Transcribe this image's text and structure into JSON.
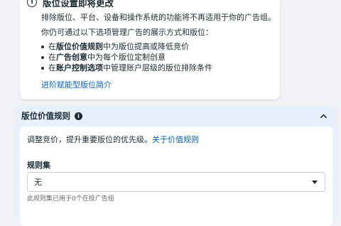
{
  "notice": {
    "title": "版位设置即将更改",
    "line1": "排除版位、平台、设备和操作系统的功能将不再适用于你的广告组。",
    "line2": "你仍可通过以下选项管理广告的展示方式和版位：",
    "bullets": [
      {
        "pre": "在",
        "bold": "版位价值规则",
        "post": "中为版位提高或降低竞价"
      },
      {
        "pre": "在",
        "bold": "广告创意",
        "post": "中为每个版位定制创意"
      },
      {
        "pre": "在",
        "bold": "账户控制选项",
        "post": "中管理账户层级的版位排除条件"
      }
    ],
    "link": "进阶赋能型版位简介",
    "info_glyph": "i"
  },
  "section": {
    "title": "版位价值规则",
    "info_glyph": "i",
    "description": "调整竞价，提升重要版位的优先级。",
    "description_link": "关于价值规则",
    "field_label": "规则集",
    "select_value": "无",
    "hint": "此规则集已用于0个在投广告组"
  },
  "colors": {
    "link": "#0a66c2",
    "section_bg": "#e8f0fb",
    "page_bg": "#f0f2f5"
  }
}
